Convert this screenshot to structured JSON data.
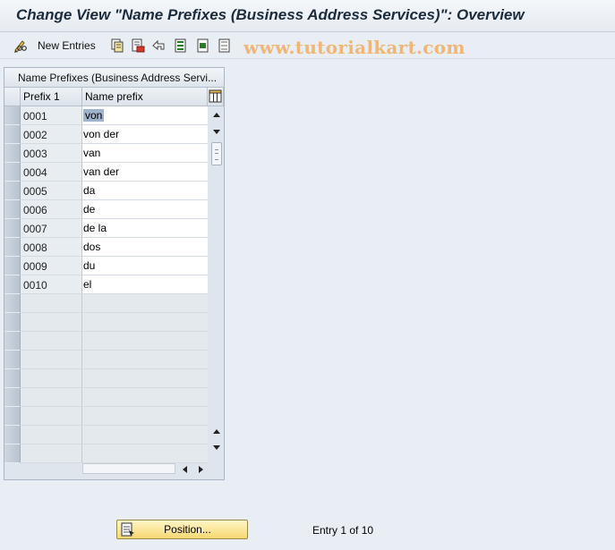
{
  "window": {
    "title": "Change View \"Name Prefixes (Business Address Services)\": Overview"
  },
  "toolbar": {
    "new_entries_label": "New Entries",
    "icons": [
      "edit-glasses-icon",
      "new-entries-icon",
      "copy-icon",
      "delete-icon",
      "undo-icon",
      "select-all-icon",
      "select-block-icon",
      "deselect-all-icon"
    ]
  },
  "watermark": "www.tutorialkart.com",
  "table": {
    "caption": "Name Prefixes (Business Address Servi...",
    "columns": [
      "Prefix 1",
      "Name prefix"
    ],
    "rows": [
      {
        "prefix": "0001",
        "name": "von"
      },
      {
        "prefix": "0002",
        "name": "von der"
      },
      {
        "prefix": "0003",
        "name": "van"
      },
      {
        "prefix": "0004",
        "name": "van der"
      },
      {
        "prefix": "0005",
        "name": "da"
      },
      {
        "prefix": "0006",
        "name": "de"
      },
      {
        "prefix": "0007",
        "name": "de la"
      },
      {
        "prefix": "0008",
        "name": "dos"
      },
      {
        "prefix": "0009",
        "name": "du"
      },
      {
        "prefix": "0010",
        "name": "el"
      }
    ],
    "empty_rows": 9
  },
  "footer": {
    "position_label": "Position...",
    "entry_info": "Entry 1 of 10"
  },
  "colors": {
    "background": "#e9eef4",
    "title_text": "#1b2b3c",
    "watermark": "#f0b676",
    "position_button": "#f6d870",
    "selection": "#9fb3cc"
  }
}
